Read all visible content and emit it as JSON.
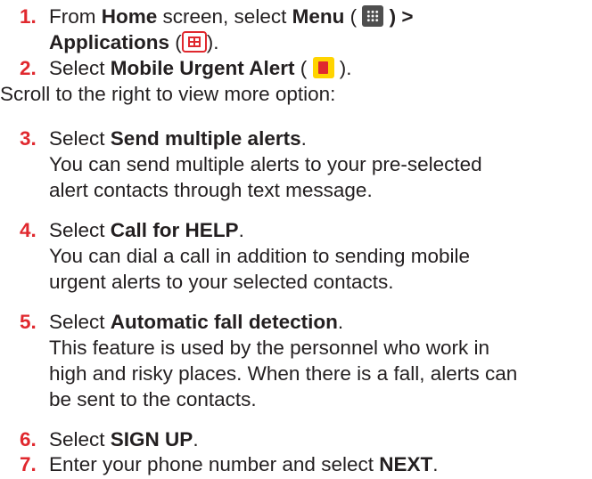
{
  "steps": [
    {
      "number": "1.",
      "lines": [
        {
          "pre": "From ",
          "b1": "Home",
          "mid": " screen, select ",
          "b2": "Menu",
          "post_icon1": " (",
          "icon1": "menu-grid-icon",
          "post": ") >"
        },
        {
          "b1": "Applications",
          "pre2": " (",
          "icon": "applications-icon",
          "post": ")."
        }
      ]
    },
    {
      "number": "2.",
      "pre": "Select ",
      "bold": "Mobile Urgent Alert",
      "paren_open": " (",
      "icon": "mobile-urgent-alert-icon",
      "paren_close": ")."
    },
    {
      "note": "Scroll to the right to view more option:"
    },
    {
      "number": "3.",
      "pre": "Select ",
      "bold": "Send multiple alerts",
      "post": ".",
      "desc": [
        "You can send multiple alerts to your pre-selected",
        "alert contacts through text message."
      ]
    },
    {
      "number": "4.",
      "pre": "Select ",
      "bold": "Call for HELP",
      "post": ".",
      "desc": [
        "You can dial a call in addition to sending mobile",
        "urgent alerts to your selected contacts."
      ]
    },
    {
      "number": "5.",
      "pre": "Select ",
      "bold": "Automatic fall detection",
      "post": ".",
      "desc": [
        "This feature is used by the personnel who work in",
        "high and risky places. When there is a fall, alerts can",
        "be sent to the contacts."
      ]
    },
    {
      "number": "6.",
      "pre": "Select ",
      "bold": "SIGN UP",
      "post": "."
    },
    {
      "number": "7.",
      "pre": "Enter your phone number and select ",
      "bold": "NEXT",
      "post": "."
    }
  ]
}
